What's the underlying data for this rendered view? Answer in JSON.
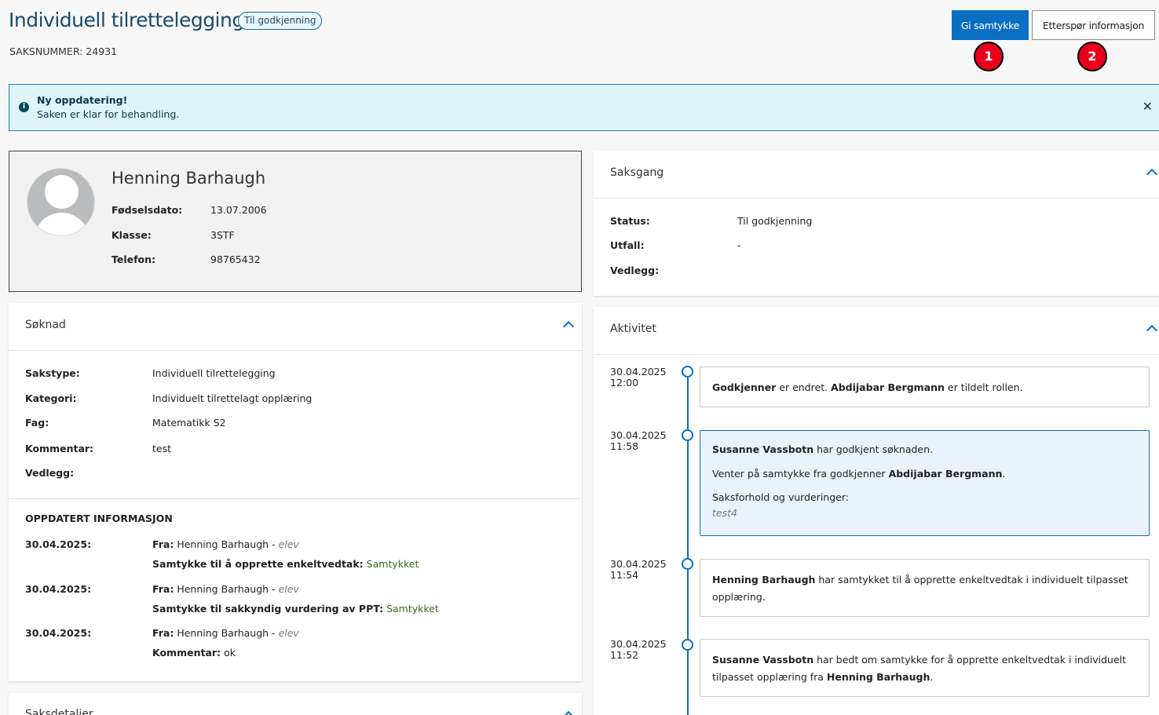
{
  "header": {
    "title": "Individuell tilrettelegging",
    "badge": "Til godkjenning",
    "saksnummer": "SAKSNUMMER: 24931",
    "approve_button": "Gi samtykke",
    "request_info_button": "Etterspør informasjon",
    "marker_1": "1",
    "marker_2": "2"
  },
  "banner": {
    "title": "Ny oppdatering!",
    "text": "Saken er klar for behandling.",
    "icon": "info-icon",
    "close_icon": "close-icon",
    "close_glyph": "✕"
  },
  "person": {
    "name": "Henning Barhaugh",
    "fields": [
      {
        "label": "Fødselsdato:",
        "value": "13.07.2006"
      },
      {
        "label": "Klasse:",
        "value": "3STF"
      },
      {
        "label": "Telefon:",
        "value": "98765432"
      }
    ]
  },
  "soknad": {
    "header": "Søknad",
    "fields": [
      {
        "label": "Sakstype:",
        "value": "Individuell tilrettelegging"
      },
      {
        "label": "Kategori:",
        "value": "Individuelt tilrettelagt opplæring"
      },
      {
        "label": "Fag:",
        "value": "Matematikk S2"
      },
      {
        "label": "Kommentar:",
        "value": "test"
      },
      {
        "label": "Vedlegg:",
        "value": ""
      }
    ],
    "updated_header": "OPPDATERT INFORMASJON",
    "updates": [
      {
        "date": "30.04.2025:",
        "from_label": "Fra:",
        "from": "Henning Barhaugh -",
        "role": "elev",
        "key": "Samtykke til å opprette enkeltvedtak:",
        "value": "Samtykket"
      },
      {
        "date": "30.04.2025:",
        "from_label": "Fra:",
        "from": "Henning Barhaugh -",
        "role": "elev",
        "key": "Samtykke til sakkyndig vurdering av PPT:",
        "value": "Samtykket"
      },
      {
        "date": "30.04.2025:",
        "from_label": "Fra:",
        "from": "Henning Barhaugh -",
        "role": "elev",
        "key": "Kommentar:",
        "value": "ok"
      }
    ]
  },
  "saksdetaljer": {
    "header": "Saksdetaljer"
  },
  "saksgang": {
    "header": "Saksgang",
    "fields": [
      {
        "label": "Status:",
        "value": "Til godkjenning"
      },
      {
        "label": "Utfall:",
        "value": "-"
      },
      {
        "label": "Vedlegg:",
        "value": ""
      }
    ]
  },
  "aktivitet": {
    "header": "Aktivitet",
    "entries": [
      {
        "date": "30.04.2025",
        "time": "12:00"
      },
      {
        "date": "30.04.2025",
        "time": "11:58"
      },
      {
        "date": "30.04.2025",
        "time": "11:54"
      },
      {
        "date": "30.04.2025",
        "time": "11:52"
      }
    ],
    "e1": {
      "b1": "Godkjenner",
      "t1": " er endret. ",
      "b2": "Abdijabar Bergmann",
      "t2": " er tildelt rollen."
    },
    "e2": {
      "b1": "Susanne Vassbotn",
      "t1": " har godkjent søknaden.",
      "t2": "Venter på samtykke fra godkjenner ",
      "b2": "Abdijabar Bergmann",
      "t3": ".",
      "t4": "Saksforhold og vurderinger:",
      "t5": "test4"
    },
    "e3": {
      "b1": "Henning Barhaugh",
      "t1": " har samtykket til å opprette enkeltvedtak i individuelt tilpasset opplæring."
    },
    "e4": {
      "b1": "Susanne Vassbotn",
      "t1": " har bedt om samtykke for å opprette enkeltvedtak i individuelt tilpasset opplæring fra ",
      "b2": "Henning Barhaugh",
      "t2": "."
    }
  },
  "colors": {
    "primary": "#0a6fc2",
    "title": "#1a4a6e",
    "banner_bg": "#dff4fb",
    "marker": "#e8001c",
    "consent_green": "#3a6d1a"
  }
}
